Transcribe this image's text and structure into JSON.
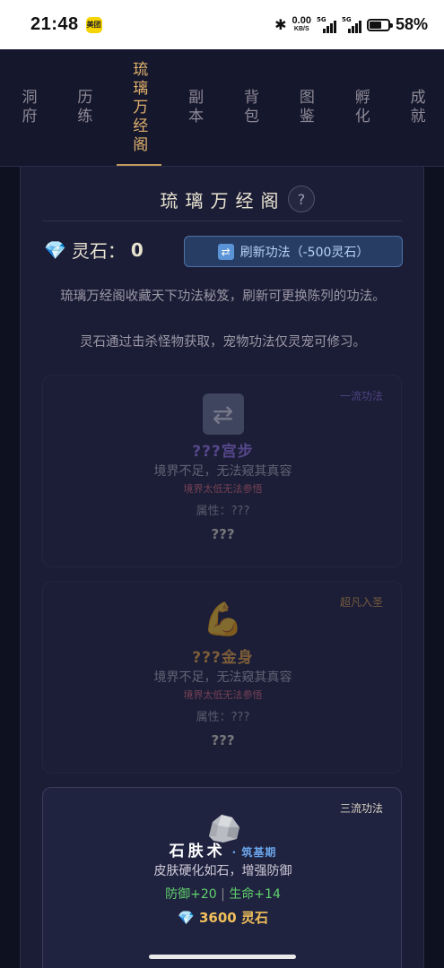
{
  "status_bar": {
    "time": "21:48",
    "app_badge": "美团",
    "net_speed_value": "0.00",
    "net_speed_unit": "KB/S",
    "signal_1_label": "5G",
    "signal_2_label": "5G",
    "battery_percent": "58%"
  },
  "nav": {
    "tabs": [
      {
        "label": "洞府",
        "active": false
      },
      {
        "label": "历练",
        "active": false
      },
      {
        "label": "琉璃万经阁",
        "active": true
      },
      {
        "label": "副本",
        "active": false
      },
      {
        "label": "背包",
        "active": false
      },
      {
        "label": "图鉴",
        "active": false
      },
      {
        "label": "孵化",
        "active": false
      },
      {
        "label": "成就",
        "active": false
      }
    ]
  },
  "library": {
    "title": "琉璃万经阁",
    "help_label": "?",
    "stone_label": "灵石：",
    "stone_value": "0",
    "refresh_button": "刷新功法（-500灵石）",
    "intro_line1": "琉璃万经阁收藏天下功法秘笈，刷新可更换陈列的功法。",
    "intro_line2": "灵石通过击杀怪物获取，宠物功法仅灵宠可修习。"
  },
  "skills": [
    {
      "tier": "一流功法",
      "tier_color": "#8e6fe0",
      "icon": "arrows-icon",
      "name": "???宫步",
      "name_color": "#9b78f0",
      "desc": "境界不足，无法窥其真容",
      "warning": "境界太低无法参悟",
      "attr": "属性：???",
      "price": "???"
    },
    {
      "tier": "超凡入圣",
      "tier_color": "#e7a24a",
      "icon": "flexed-arm-icon",
      "name": "???金身",
      "name_color": "#f2a93b",
      "desc": "境界不足，无法窥其真容",
      "warning": "境界太低无法参悟",
      "attr": "属性：???",
      "price": "???"
    },
    {
      "tier": "三流功法",
      "tier_color": "#d9d4c3",
      "icon": "rock-icon",
      "name": "石肤术",
      "name_color": "#ffffff",
      "realm": "· 筑基期",
      "desc": "皮肤硬化如石，增强防御",
      "stat1": "防御+20",
      "stat_sep": "|",
      "stat2": "生命+14",
      "price": "3600 灵石"
    }
  ]
}
